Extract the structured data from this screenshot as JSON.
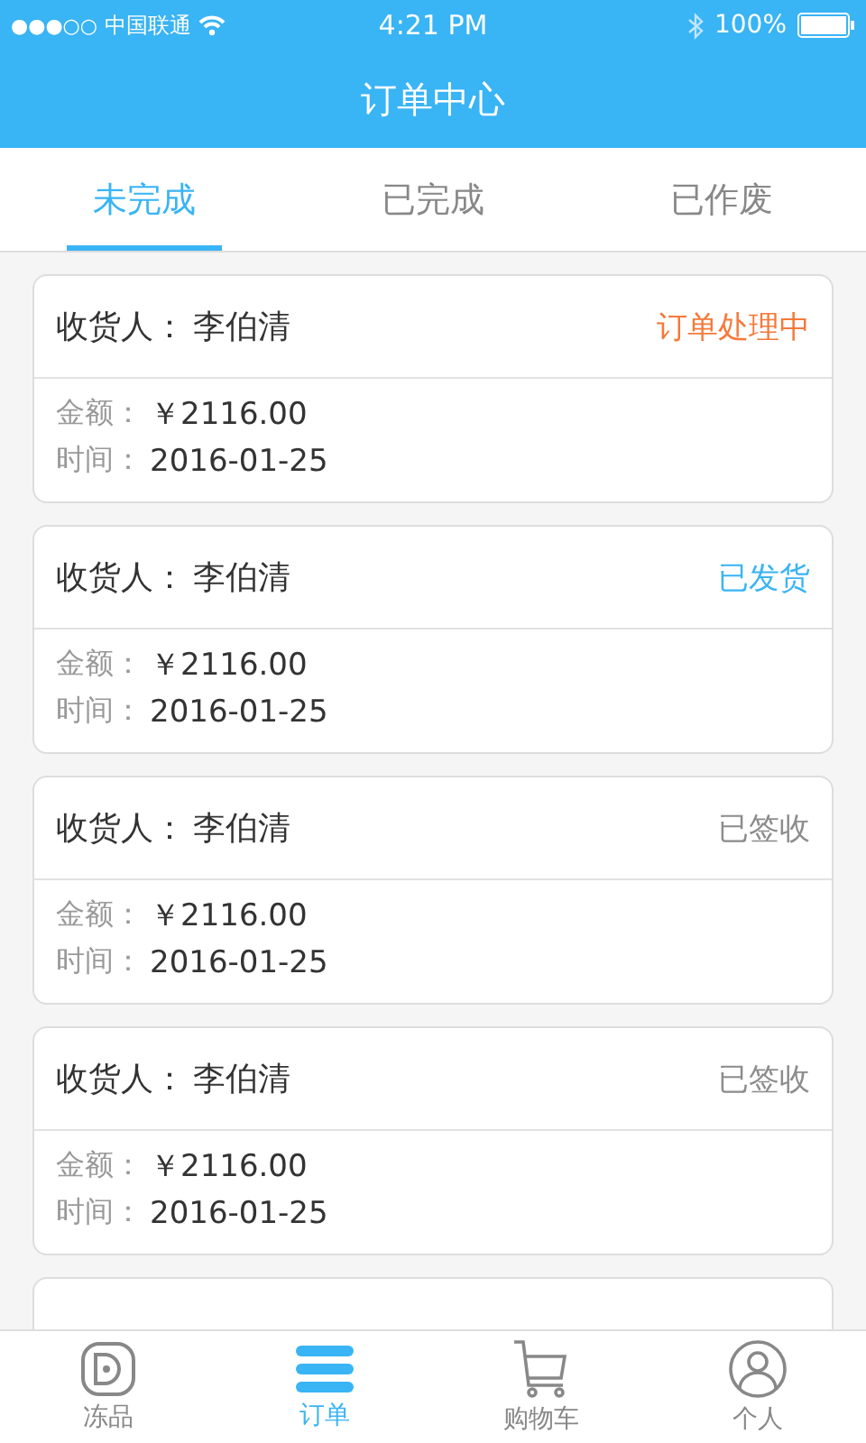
{
  "status_bar": {
    "signal": "●●●○○",
    "carrier": "中国联通",
    "time": "4:21 PM",
    "battery": "100%"
  },
  "title": "订单中心",
  "tabs": [
    {
      "label": "未完成",
      "selected": true
    },
    {
      "label": "已完成",
      "selected": false
    },
    {
      "label": "已作废",
      "selected": false
    }
  ],
  "orders": [
    {
      "consignee_label": "收货人：",
      "consignee": "李伯清",
      "status": "订单处理中",
      "color": "#f5793a",
      "amount_label": "金额：",
      "amount": "￥2116.00",
      "time_label": "时间：",
      "time": "2016-01-25"
    },
    {
      "consignee_label": "收货人：",
      "consignee": "李伯清",
      "status": "已发货",
      "color": "#39b4f4",
      "amount_label": "金额：",
      "amount": "￥2116.00",
      "time_label": "时间：",
      "time": "2016-01-25"
    },
    {
      "consignee_label": "收货人：",
      "consignee": "李伯清",
      "status": "已签收",
      "color": "#8c8c8c",
      "amount_label": "金额：",
      "amount": "￥2116.00",
      "time_label": "时间：",
      "time": "2016-01-25"
    },
    {
      "consignee_label": "收货人：",
      "consignee": "李伯清",
      "status": "已签收",
      "color": "#8c8c8c",
      "amount_label": "金额：",
      "amount": "￥2116.00",
      "time_label": "时间：",
      "time": "2016-01-25"
    }
  ],
  "bottom_nav": [
    {
      "kind": "frozen",
      "label": "冻品",
      "selected": false
    },
    {
      "kind": "orders",
      "label": "订单",
      "selected": true
    },
    {
      "kind": "cart",
      "label": "购物车",
      "selected": false
    },
    {
      "kind": "profile",
      "label": "个人",
      "selected": false
    }
  ]
}
